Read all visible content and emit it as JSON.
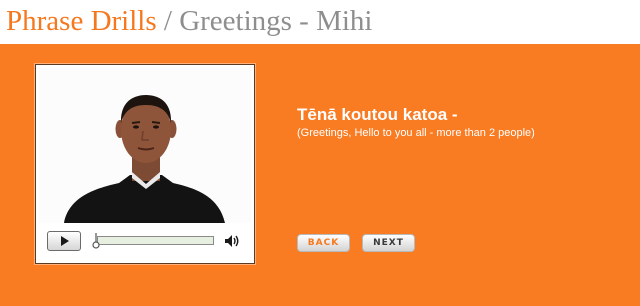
{
  "header": {
    "section": "Phrase Drills",
    "separator": " / ",
    "page": "Greetings - Mihi"
  },
  "lesson": {
    "phrase": "Tēnā koutou katoa -",
    "translation": "(Greetings, Hello to you all - more than 2 people)"
  },
  "player": {
    "progress": 0,
    "play_icon": "play-icon",
    "volume_icon": "speaker-icon"
  },
  "nav": {
    "back_label": "BACK",
    "next_label": "NEXT"
  },
  "colors": {
    "accent": "#f97b22",
    "title_orange": "#f5781f",
    "title_gray": "#8e8e8e"
  }
}
